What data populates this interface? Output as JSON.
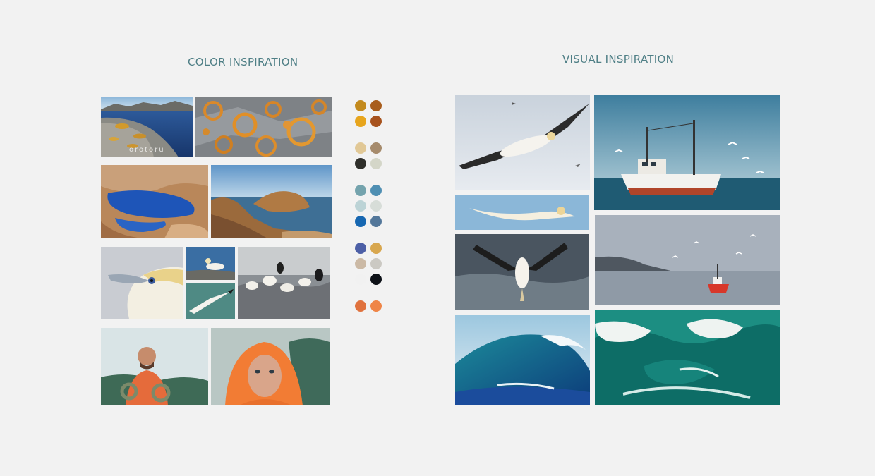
{
  "headings": {
    "color": "COLOR INSPIRATION",
    "visual": "VISUAL INSPIRATION"
  },
  "color_inspiration": {
    "photos": [
      {
        "name": "rocky-lake-photo",
        "watermark": "orotoru"
      },
      {
        "name": "orange-lichen-rock-photo"
      },
      {
        "name": "blue-rock-pool-photo"
      },
      {
        "name": "rocky-coastline-photo"
      },
      {
        "name": "gannet-head-closeup-photo"
      },
      {
        "name": "gannet-on-rock-photo"
      },
      {
        "name": "gannet-over-water-photo"
      },
      {
        "name": "gannet-colony-photo"
      },
      {
        "name": "fisherman-with-rope-photo"
      },
      {
        "name": "man-in-orange-hood-photo"
      }
    ]
  },
  "palette": {
    "groups": [
      [
        "#c38a1e",
        "#a85d1c",
        "#e7a51d",
        "#a7521d"
      ],
      [
        "#e1c896",
        "#a68b6c",
        "#2f2f2b",
        "#d4d6c8"
      ],
      [
        "#74a3ad",
        "#4f8fb3",
        "#bcd3d6",
        "#d7ddd8",
        "#1767b1",
        "#53779a"
      ],
      [
        "#4c5fa6",
        "#d8a74f",
        "#cbb9a5",
        "#cbc9c3",
        "#f1f1f1",
        "#0e1218"
      ],
      [
        "#e0723e",
        "#ef8547"
      ]
    ]
  },
  "visual_inspiration": {
    "photos": [
      {
        "name": "gannet-in-flight-photo"
      },
      {
        "name": "fishing-boat-with-gulls-photo"
      },
      {
        "name": "gannet-gliding-photo"
      },
      {
        "name": "gannet-diving-photo"
      },
      {
        "name": "boat-in-fjord-photo"
      },
      {
        "name": "blue-curling-wave-photo"
      },
      {
        "name": "green-breaking-wave-photo"
      }
    ]
  }
}
